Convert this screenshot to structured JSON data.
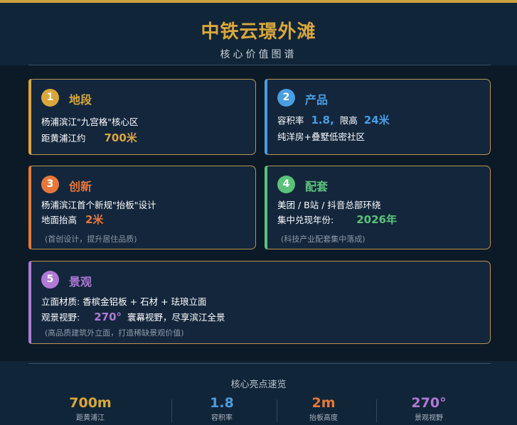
{
  "header": {
    "title": "中铁云璟外滩",
    "subtitle": "核心价值图谱"
  },
  "colors": {
    "gold": "#d9a73c",
    "blue": "#4a9de0",
    "orange": "#e8783a",
    "green": "#5cc27a",
    "purple": "#b07ad6",
    "card_border": "#b8964e"
  },
  "cards": {
    "location": {
      "number": "1",
      "title": "地段",
      "line1": "杨浦滨江\"九宫格\"核心区",
      "line2_label": "距黄浦江约",
      "line2_value": "700米"
    },
    "product": {
      "number": "2",
      "title": "产品",
      "far_label": "容积率",
      "far_value": "1.8,",
      "height_label": "限高",
      "height_value": "24米",
      "line2": "纯洋房+叠墅低密社区"
    },
    "innovation": {
      "number": "3",
      "title": "创新",
      "line1": "杨浦滨江首个新规\"抬板\"设计",
      "line2_label": "地面抬高",
      "line2_value": "2米",
      "note": "(首创设计，提升居住品质)"
    },
    "amenities": {
      "number": "4",
      "title": "配套",
      "line1": "美团 / B站 / 抖音总部环绕",
      "line2_label": "集中兑现年份:",
      "line2_value": "2026年",
      "note": "(科技产业配套集中落成)"
    },
    "landscape": {
      "number": "5",
      "title": "景观",
      "line1": "立面材质: 香槟金铝板 + 石材 + 珐琅立面",
      "line2_label": "观景视野:",
      "line2_value": "270°",
      "line2_suffix": "寰幕视野，尽享滨江全景",
      "note": "(高品质建筑外立面，打造稀缺景观价值)"
    }
  },
  "footer": {
    "title": "核心亮点速览",
    "stats": [
      {
        "value": "700m",
        "label": "距黄浦江"
      },
      {
        "value": "1.8",
        "label": "容积率"
      },
      {
        "value": "2m",
        "label": "抬板高度"
      },
      {
        "value": "270°",
        "label": "景观视野"
      }
    ]
  }
}
